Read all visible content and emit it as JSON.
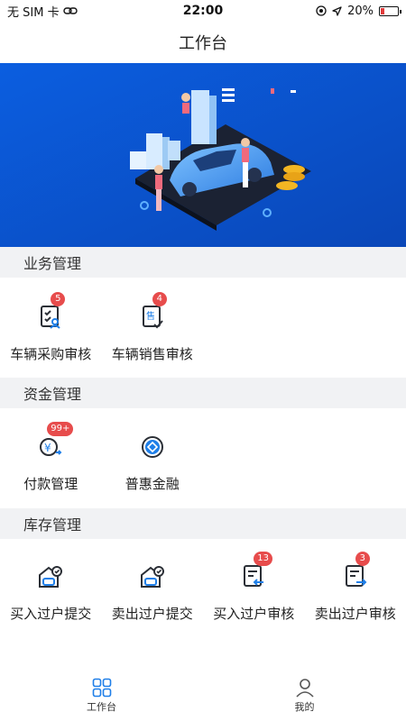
{
  "status_bar": {
    "carrier": "无 SIM 卡",
    "time": "22:00",
    "battery_percent": "20%",
    "battery_level": 0.2,
    "battery_color": "#e23b3b"
  },
  "nav": {
    "title": "工作台"
  },
  "sections": {
    "business": {
      "title": "业务管理",
      "items": [
        {
          "label": "车辆采购审核",
          "badge": "5",
          "icon": "purchase-review-icon"
        },
        {
          "label": "车辆销售审核",
          "badge": "4",
          "icon": "sales-review-icon"
        }
      ]
    },
    "funds": {
      "title": "资金管理",
      "items": [
        {
          "label": "付款管理",
          "badge": "99+",
          "icon": "payment-icon"
        },
        {
          "label": "普惠金融",
          "badge": "",
          "icon": "finance-icon"
        }
      ]
    },
    "inventory": {
      "title": "库存管理",
      "items": [
        {
          "label": "买入过户提交",
          "badge": "",
          "icon": "buy-transfer-submit-icon"
        },
        {
          "label": "卖出过户提交",
          "badge": "",
          "icon": "sell-transfer-submit-icon"
        },
        {
          "label": "买入过户审核",
          "badge": "13",
          "icon": "buy-transfer-review-icon"
        },
        {
          "label": "卖出过户审核",
          "badge": "3",
          "icon": "sell-transfer-review-icon"
        }
      ]
    }
  },
  "tab_bar": {
    "tabs": [
      {
        "label": "工作台",
        "icon": "grid-icon",
        "active": true
      },
      {
        "label": "我的",
        "icon": "user-icon",
        "active": false
      }
    ]
  },
  "colors": {
    "accent": "#1f7fe8",
    "badge": "#e74c4c",
    "banner": "#0f66e0",
    "section_bg": "#f1f2f4"
  }
}
